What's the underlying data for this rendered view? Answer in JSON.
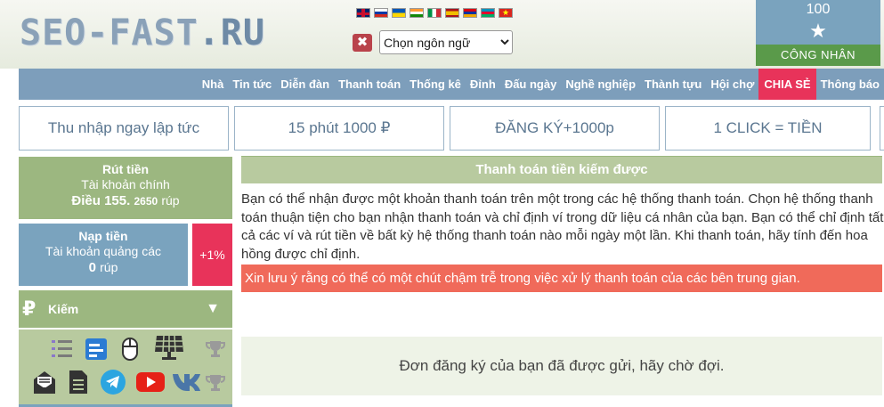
{
  "header": {
    "logo_main": "SEO-FAST",
    "logo_ru": ".RU",
    "language_select": {
      "selected": "Chọn ngôn ngữ"
    },
    "language_close": "✖",
    "rank": {
      "value": "100",
      "label": "CÔNG  NHÂN"
    }
  },
  "nav": {
    "items": [
      "Nhà",
      "Tin tức",
      "Diễn đàn",
      "Thanh toán",
      "Thống kê",
      "Đỉnh",
      "Đấu ngày",
      "Nghề nghiệp",
      "Thành tựu",
      "Hội chợ",
      "CHIA SẺ",
      "Thông báo"
    ]
  },
  "banners": [
    "Thu nhập ngay lập tức",
    "15 phút 1000 ₽",
    "ĐĂNG KÝ+1000p",
    "1 CLICK = TIỀN"
  ],
  "sidebar": {
    "withdraw": {
      "title": "Rút tiền",
      "account": "Tài khoản chính",
      "balance_main": "Điều 155.",
      "balance_small": "2650",
      "unit": "rúp"
    },
    "deposit": {
      "title": "Nạp tiền",
      "account": "Tài khoản quảng các",
      "balance": "0",
      "unit": "rúp",
      "bonus": "+1%"
    },
    "earn": {
      "icon": "₽",
      "label": "Kiếm"
    }
  },
  "main": {
    "title": "Thanh toán tiền kiếm được",
    "paragraph": "Bạn có thể nhận được một khoản thanh toán trên một trong các hệ thống thanh toán. Chọn hệ thống thanh toán thuận tiện cho bạn nhận thanh toán và chỉ định ví trong dữ liệu cá nhân của bạn. Bạn có thể chỉ định tất cả các ví và rút tiền về bất kỳ hệ thống thanh toán nào mỗi ngày một lần. Khi thanh toán, hãy tính đến hoa hồng được chỉ định.",
    "notice": "Xin lưu ý rằng có thể có một chút chậm trễ trong việc xử lý thanh toán của các bên trung gian.",
    "pending": "Đơn đăng ký của bạn đã được gửi, hãy chờ đợi."
  },
  "colors": {
    "nav_bg": "#7d9ebb",
    "green": "#9cb780",
    "accent_pink": "#e8335a",
    "notice_red": "#f06a5a"
  }
}
